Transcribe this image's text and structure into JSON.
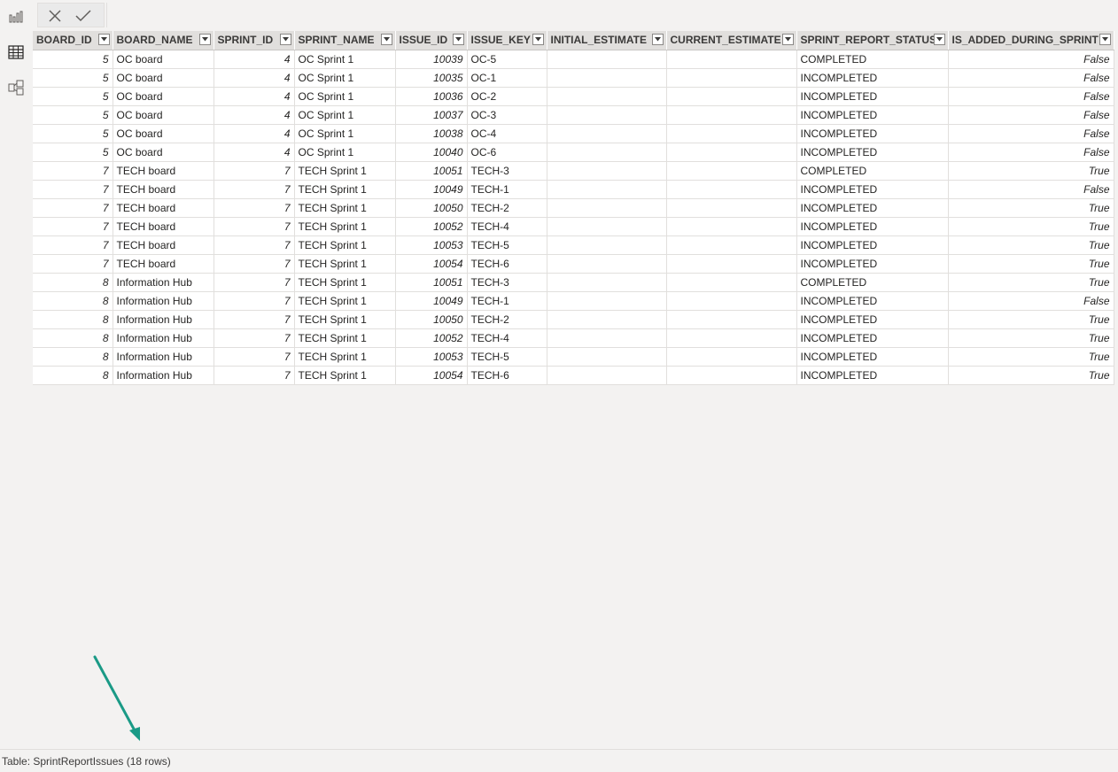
{
  "left_rail": {
    "icons": [
      "report-view-icon",
      "data-view-icon",
      "model-view-icon"
    ]
  },
  "formula_bar": {
    "cancel_icon": "close-icon",
    "commit_icon": "checkmark-icon",
    "formula": ""
  },
  "table": {
    "columns": [
      {
        "label": "BOARD_ID"
      },
      {
        "label": "BOARD_NAME"
      },
      {
        "label": "SPRINT_ID"
      },
      {
        "label": "SPRINT_NAME"
      },
      {
        "label": "ISSUE_ID"
      },
      {
        "label": "ISSUE_KEY"
      },
      {
        "label": "INITIAL_ESTIMATE"
      },
      {
        "label": "CURRENT_ESTIMATE"
      },
      {
        "label": "SPRINT_REPORT_STATUS"
      },
      {
        "label": "IS_ADDED_DURING_SPRINT"
      }
    ],
    "rows": [
      [
        "5",
        "OC board",
        "4",
        "OC Sprint 1",
        "10039",
        "OC-5",
        "",
        "",
        "COMPLETED",
        "False"
      ],
      [
        "5",
        "OC board",
        "4",
        "OC Sprint 1",
        "10035",
        "OC-1",
        "",
        "",
        "INCOMPLETED",
        "False"
      ],
      [
        "5",
        "OC board",
        "4",
        "OC Sprint 1",
        "10036",
        "OC-2",
        "",
        "",
        "INCOMPLETED",
        "False"
      ],
      [
        "5",
        "OC board",
        "4",
        "OC Sprint 1",
        "10037",
        "OC-3",
        "",
        "",
        "INCOMPLETED",
        "False"
      ],
      [
        "5",
        "OC board",
        "4",
        "OC Sprint 1",
        "10038",
        "OC-4",
        "",
        "",
        "INCOMPLETED",
        "False"
      ],
      [
        "5",
        "OC board",
        "4",
        "OC Sprint 1",
        "10040",
        "OC-6",
        "",
        "",
        "INCOMPLETED",
        "False"
      ],
      [
        "7",
        "TECH board",
        "7",
        "TECH Sprint 1",
        "10051",
        "TECH-3",
        "",
        "",
        "COMPLETED",
        "True"
      ],
      [
        "7",
        "TECH board",
        "7",
        "TECH Sprint 1",
        "10049",
        "TECH-1",
        "",
        "",
        "INCOMPLETED",
        "False"
      ],
      [
        "7",
        "TECH board",
        "7",
        "TECH Sprint 1",
        "10050",
        "TECH-2",
        "",
        "",
        "INCOMPLETED",
        "True"
      ],
      [
        "7",
        "TECH board",
        "7",
        "TECH Sprint 1",
        "10052",
        "TECH-4",
        "",
        "",
        "INCOMPLETED",
        "True"
      ],
      [
        "7",
        "TECH board",
        "7",
        "TECH Sprint 1",
        "10053",
        "TECH-5",
        "",
        "",
        "INCOMPLETED",
        "True"
      ],
      [
        "7",
        "TECH board",
        "7",
        "TECH Sprint 1",
        "10054",
        "TECH-6",
        "",
        "",
        "INCOMPLETED",
        "True"
      ],
      [
        "8",
        "Information Hub",
        "7",
        "TECH Sprint 1",
        "10051",
        "TECH-3",
        "",
        "",
        "COMPLETED",
        "True"
      ],
      [
        "8",
        "Information Hub",
        "7",
        "TECH Sprint 1",
        "10049",
        "TECH-1",
        "",
        "",
        "INCOMPLETED",
        "False"
      ],
      [
        "8",
        "Information Hub",
        "7",
        "TECH Sprint 1",
        "10050",
        "TECH-2",
        "",
        "",
        "INCOMPLETED",
        "True"
      ],
      [
        "8",
        "Information Hub",
        "7",
        "TECH Sprint 1",
        "10052",
        "TECH-4",
        "",
        "",
        "INCOMPLETED",
        "True"
      ],
      [
        "8",
        "Information Hub",
        "7",
        "TECH Sprint 1",
        "10053",
        "TECH-5",
        "",
        "",
        "INCOMPLETED",
        "True"
      ],
      [
        "8",
        "Information Hub",
        "7",
        "TECH Sprint 1",
        "10054",
        "TECH-6",
        "",
        "",
        "INCOMPLETED",
        "True"
      ]
    ]
  },
  "status_bar": {
    "text": "Table: SprintReportIssues (18 rows)"
  },
  "colors": {
    "annotation_arrow": "#1a9a86"
  }
}
